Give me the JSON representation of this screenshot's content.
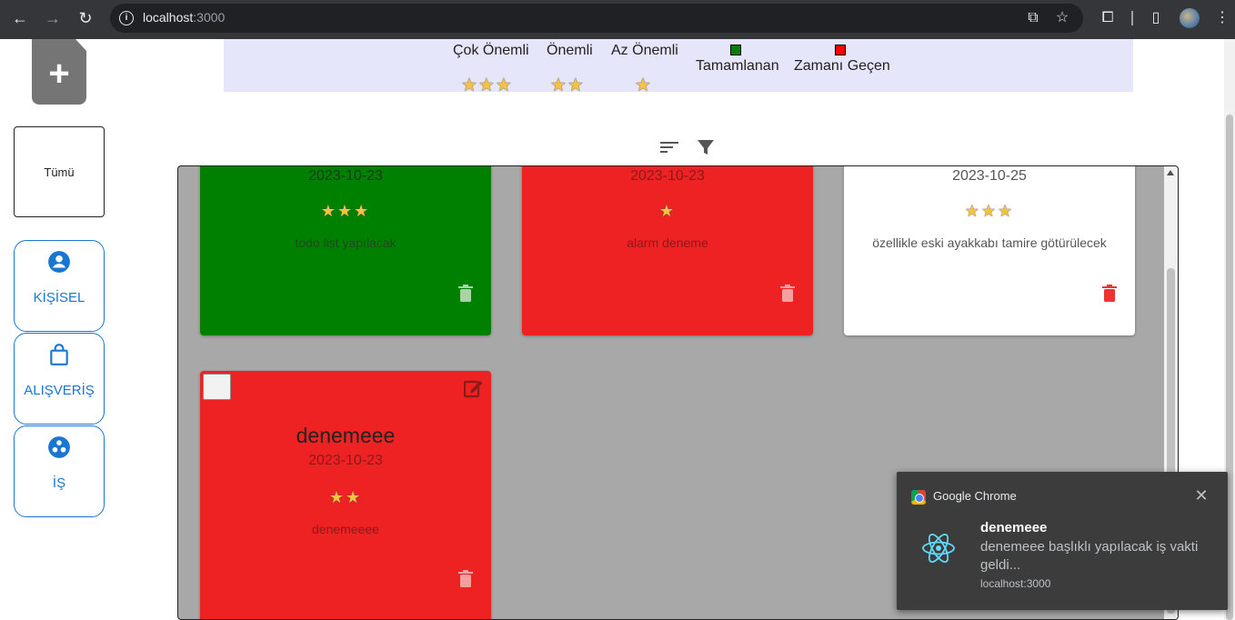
{
  "browser": {
    "url_host": "localhost",
    "url_port": ":3000"
  },
  "sidebar": {
    "all_label": "Tümü",
    "categories": [
      {
        "label": "KİŞİSEL",
        "icon": "person-icon"
      },
      {
        "label": "ALIŞVERİŞ",
        "icon": "shopping-bag-icon"
      },
      {
        "label": "İŞ",
        "icon": "workspaces-icon"
      }
    ]
  },
  "legend": {
    "high": {
      "label": "Çok Önemli",
      "stars": "★★★"
    },
    "medium": {
      "label": "Önemli",
      "stars": "★★"
    },
    "low": {
      "label": "Az Önemli",
      "stars": "★"
    },
    "completed": {
      "label": "Tamamlanan",
      "color": "#008000"
    },
    "overdue": {
      "label": "Zamanı Geçen",
      "color": "#ff0000"
    }
  },
  "cards": [
    {
      "date": "2023-10-23",
      "stars": "★★★",
      "description": "todo list yapılacak",
      "status": "completed",
      "color": "#008000"
    },
    {
      "date": "2023-10-23",
      "stars": "★",
      "description": "alarm deneme",
      "status": "overdue",
      "color": "#ee2222"
    },
    {
      "date": "2023-10-25",
      "stars": "★★★",
      "description": "özellikle eski ayakkabı tamire götürülecek",
      "status": "normal",
      "color": "#ffffff"
    },
    {
      "title": "denemeee",
      "date": "2023-10-23",
      "stars": "★★",
      "description": "denemeeee",
      "status": "overdue",
      "color": "#ee2222"
    }
  ],
  "notification": {
    "app_name": "Google Chrome",
    "title": "denemeee",
    "body": "denemeee başlıklı yapılacak iş vakti geldi...",
    "origin": "localhost:3000",
    "close_glyph": "✕"
  }
}
